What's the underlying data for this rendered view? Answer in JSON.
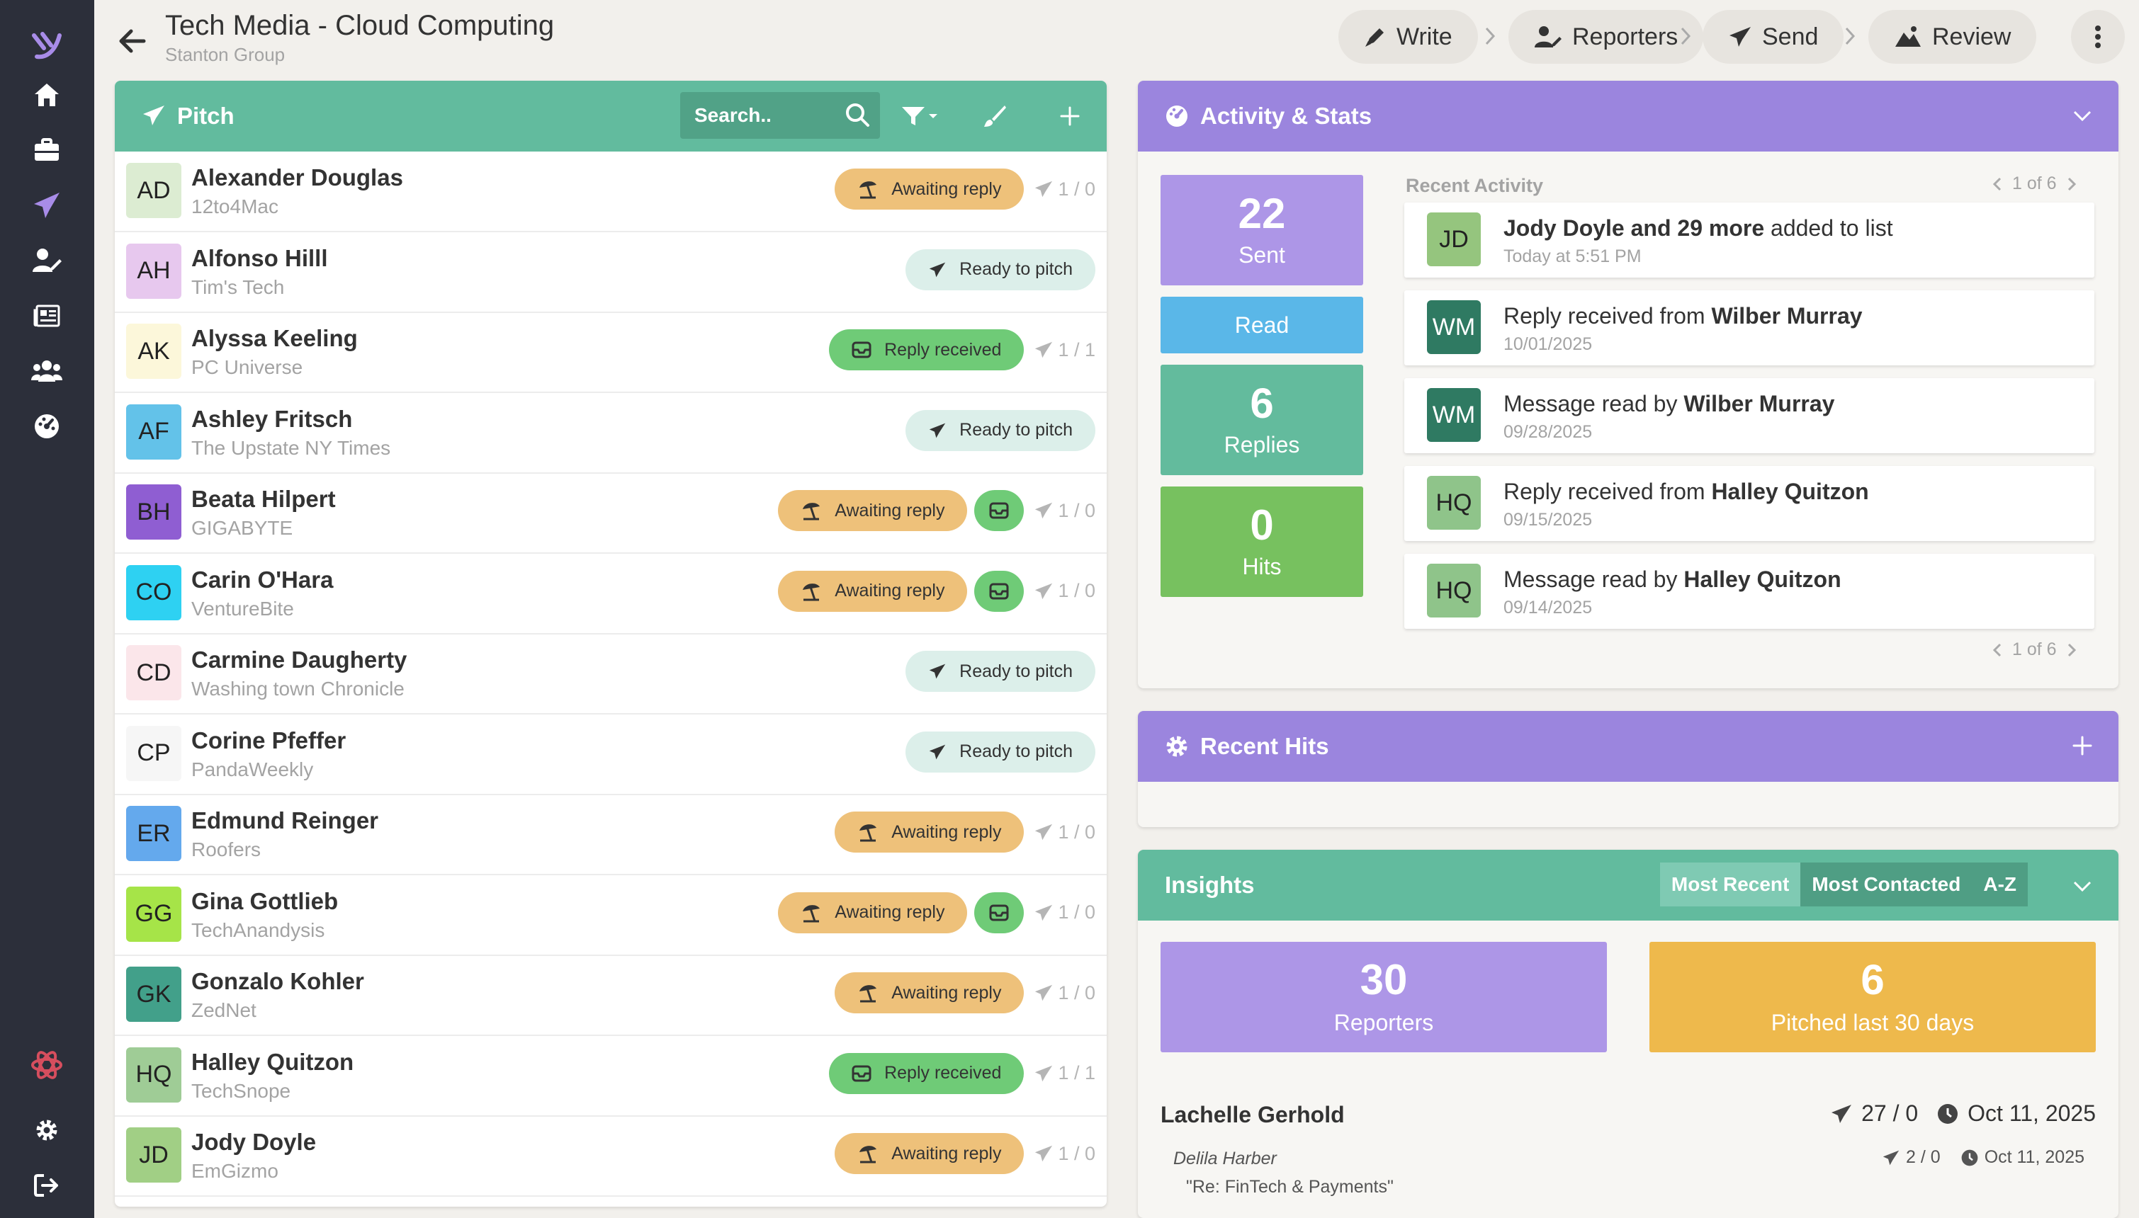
{
  "header": {
    "title": "Tech Media - Cloud Computing",
    "subtitle": "Stanton Group",
    "steps": [
      "Write",
      "Reporters",
      "Send",
      "Review"
    ]
  },
  "pitch": {
    "title": "Pitch",
    "search_placeholder": "Search..",
    "rows": [
      {
        "initials": "AD",
        "name": "Alexander Douglas",
        "outlet": "12to4Mac",
        "status": "Awaiting reply",
        "extra": false,
        "counts": "1 / 0",
        "color": "#dcecd2"
      },
      {
        "initials": "AH",
        "name": "Alfonso Hilll",
        "outlet": "Tim's Tech",
        "status": "Ready to pitch",
        "extra": false,
        "counts": "",
        "color": "#e7c8ee"
      },
      {
        "initials": "AK",
        "name": "Alyssa Keeling",
        "outlet": "PC Universe",
        "status": "Reply received",
        "extra": false,
        "counts": "1 / 1",
        "color": "#fcf7da"
      },
      {
        "initials": "AF",
        "name": "Ashley Fritsch",
        "outlet": "The Upstate NY Times",
        "status": "Ready to pitch",
        "extra": false,
        "counts": "",
        "color": "#63c2e9"
      },
      {
        "initials": "BH",
        "name": "Beata Hilpert",
        "outlet": "GIGABYTE",
        "status": "Awaiting reply",
        "extra": true,
        "counts": "1 / 0",
        "color": "#8f5ed2"
      },
      {
        "initials": "CO",
        "name": "Carin O'Hara",
        "outlet": "VentureBite",
        "status": "Awaiting reply",
        "extra": true,
        "counts": "1 / 0",
        "color": "#2ed1f2"
      },
      {
        "initials": "CD",
        "name": "Carmine Daugherty",
        "outlet": "Washing town Chronicle",
        "status": "Ready to pitch",
        "extra": false,
        "counts": "",
        "color": "#fbe6ea"
      },
      {
        "initials": "CP",
        "name": "Corine Pfeffer",
        "outlet": "PandaWeekly",
        "status": "Ready to pitch",
        "extra": false,
        "counts": "",
        "color": "#f6f6f6"
      },
      {
        "initials": "ER",
        "name": "Edmund Reinger",
        "outlet": "Roofers",
        "status": "Awaiting reply",
        "extra": false,
        "counts": "1 / 0",
        "color": "#64a9ed"
      },
      {
        "initials": "GG",
        "name": "Gina Gottlieb",
        "outlet": "TechAnandysis",
        "status": "Awaiting reply",
        "extra": true,
        "counts": "1 / 0",
        "color": "#a6e448"
      },
      {
        "initials": "GK",
        "name": "Gonzalo Kohler",
        "outlet": "ZedNet",
        "status": "Awaiting reply",
        "extra": false,
        "counts": "1 / 0",
        "color": "#42a08a"
      },
      {
        "initials": "HQ",
        "name": "Halley Quitzon",
        "outlet": "TechSnope",
        "status": "Reply received",
        "extra": false,
        "counts": "1 / 1",
        "color": "#9fcc96"
      },
      {
        "initials": "JD",
        "name": "Jody Doyle",
        "outlet": "EmGizmo",
        "status": "Awaiting reply",
        "extra": false,
        "counts": "1 / 0",
        "color": "#a1cf85"
      }
    ]
  },
  "activity": {
    "title": "Activity & Stats",
    "stats": [
      {
        "num": "22",
        "label": "Sent",
        "color": "#ad96e7"
      },
      {
        "num": "",
        "label": "Read",
        "color": "#5ab7e8"
      },
      {
        "num": "6",
        "label": "Replies",
        "color": "#63bb9d"
      },
      {
        "num": "0",
        "label": "Hits",
        "color": "#77c15f"
      }
    ],
    "recent_label": "Recent Activity",
    "pager": "1 of 6",
    "items": [
      {
        "initials": "JD",
        "color": "#95c57e",
        "pre": "",
        "bold": "Jody Doyle and 29 more",
        "post": " added to list",
        "date": "Today at 5:51 PM"
      },
      {
        "initials": "WM",
        "color": "#2f7a62",
        "pre": "Reply received from ",
        "bold": "Wilber Murray",
        "post": "",
        "date": "10/01/2025"
      },
      {
        "initials": "WM",
        "color": "#2f7a62",
        "pre": "Message read by ",
        "bold": "Wilber Murray",
        "post": "",
        "date": "09/28/2025"
      },
      {
        "initials": "HQ",
        "color": "#8fc48a",
        "pre": "Reply received from ",
        "bold": "Halley Quitzon",
        "post": "",
        "date": "09/15/2025"
      },
      {
        "initials": "HQ",
        "color": "#8fc48a",
        "pre": "Message read by ",
        "bold": "Halley Quitzon",
        "post": "",
        "date": "09/14/2025"
      }
    ]
  },
  "hits": {
    "title": "Recent Hits"
  },
  "insights": {
    "title": "Insights",
    "tabs": [
      "Most Recent",
      "Most Contacted",
      "A-Z"
    ],
    "cards": [
      {
        "num": "30",
        "label": "Reporters",
        "color": "#ad96e7"
      },
      {
        "num": "6",
        "label": "Pitched last 30 days",
        "color": "#eeb94c"
      }
    ],
    "reporter": {
      "name": "Lachelle Gerhold",
      "counts": "27 / 0",
      "date": "Oct 11, 2025"
    },
    "sub": {
      "name": "Delila Harber",
      "counts": "2 / 0",
      "date": "Oct 11, 2025",
      "subject": "\"Re: FinTech & Payments\""
    }
  },
  "colors": {
    "teal": "#62bb9e",
    "purple": "#9b85de",
    "sidebar": "#2c2f3a"
  }
}
